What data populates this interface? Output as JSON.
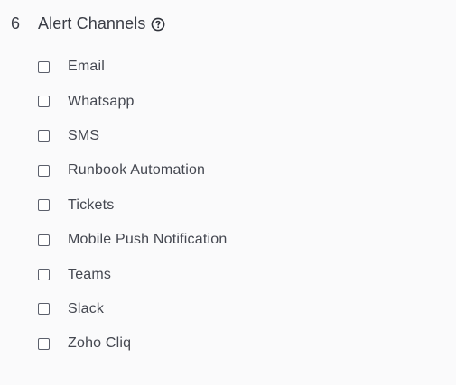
{
  "section": {
    "step_number": "6",
    "title": "Alert Channels",
    "help_icon": "question-circle-icon"
  },
  "channels": [
    {
      "label": "Email",
      "checked": false
    },
    {
      "label": "Whatsapp",
      "checked": false
    },
    {
      "label": "SMS",
      "checked": false
    },
    {
      "label": "Runbook Automation",
      "checked": false
    },
    {
      "label": "Tickets",
      "checked": false
    },
    {
      "label": "Mobile Push Notification",
      "checked": false
    },
    {
      "label": "Teams",
      "checked": false
    },
    {
      "label": "Slack",
      "checked": false
    },
    {
      "label": "Zoho Cliq",
      "checked": false
    }
  ],
  "colors": {
    "background": "#fafafb",
    "text": "#3a3d46",
    "checkbox_border": "#5b5f6b"
  }
}
